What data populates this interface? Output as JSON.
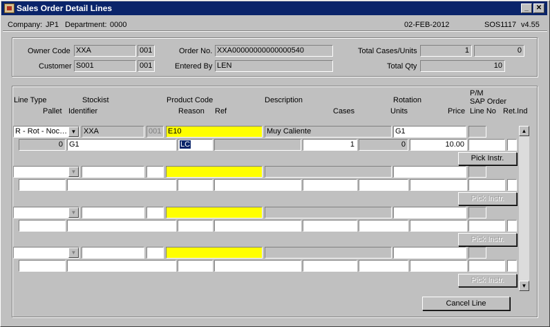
{
  "window": {
    "title": "Sales Order Detail Lines",
    "minimize": "_",
    "close": "✕"
  },
  "header": {
    "company_label": "Company:",
    "company": "JP1",
    "department_label": "Department:",
    "department": "0000",
    "date": "02-FEB-2012",
    "screen_id": "SOS1117",
    "version": "v4.55"
  },
  "order": {
    "owner_code_label": "Owner Code",
    "owner_code": "XXA",
    "owner_code_suffix": "001",
    "customer_label": "Customer",
    "customer": "S001",
    "customer_suffix": "001",
    "order_no_label": "Order No.",
    "order_no": "XXA00000000000000540",
    "entered_by_label": "Entered By",
    "entered_by": "LEN",
    "total_cases_label": "Total Cases/Units",
    "total_cases": "1",
    "total_units": "0",
    "total_qty_label": "Total Qty",
    "total_qty": "10"
  },
  "columns": {
    "line_type": "Line Type",
    "stockist": "Stockist",
    "product_code": "Product Code",
    "description": "Description",
    "rotation": "Rotation",
    "pm": "P/M",
    "sap_order": "SAP Order",
    "pallet": "Pallet",
    "identifier": "Identifier",
    "reason": "Reason",
    "ref": "Ref",
    "cases": "Cases",
    "units": "Units",
    "price": "Price",
    "line_no": "Line No",
    "ret_ind": "Ret.Ind"
  },
  "lines": [
    {
      "line_type": "R - Rot - Noc…",
      "stockist": "XXA",
      "stockist_suffix": "001",
      "product_code": "E10",
      "description": "Muy Caliente",
      "rotation": "G1",
      "pallet": "0",
      "identifier": "G1",
      "reason": "LC",
      "ref": "",
      "cases": "1",
      "units": "0",
      "price": "10.00",
      "pick_label": "Pick Instr."
    },
    {
      "line_type": "",
      "stockist": "",
      "stockist_suffix": "",
      "product_code": "",
      "description": "",
      "rotation": "",
      "pallet": "",
      "identifier": "",
      "reason": "",
      "ref": "",
      "cases": "",
      "units": "",
      "price": "",
      "pick_label": "Pick Instr."
    },
    {
      "line_type": "",
      "stockist": "",
      "stockist_suffix": "",
      "product_code": "",
      "description": "",
      "rotation": "",
      "pallet": "",
      "identifier": "",
      "reason": "",
      "ref": "",
      "cases": "",
      "units": "",
      "price": "",
      "pick_label": "Pick Instr."
    },
    {
      "line_type": "",
      "stockist": "",
      "stockist_suffix": "",
      "product_code": "",
      "description": "",
      "rotation": "",
      "pallet": "",
      "identifier": "",
      "reason": "",
      "ref": "",
      "cases": "",
      "units": "",
      "price": "",
      "pick_label": "Pick Instr."
    }
  ],
  "cancel_line_label": "Cancel Line",
  "scrollbar": {
    "up_icon": "arrow-up-icon",
    "down_icon": "arrow-down-icon"
  }
}
